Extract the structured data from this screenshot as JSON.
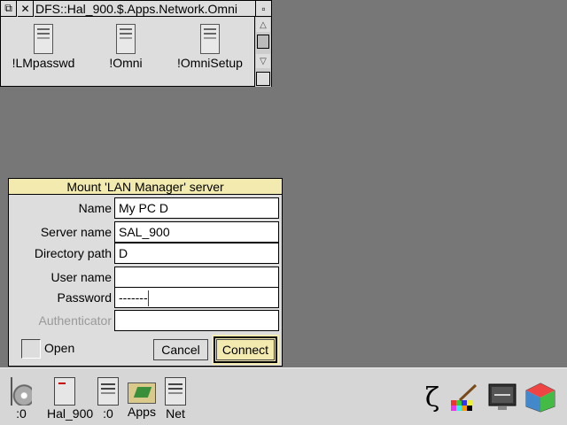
{
  "filer": {
    "title": "DFS::Hal_900.$.Apps.Network.Omni",
    "files": [
      "!LMpasswd",
      "!Omni",
      "!OmniSetup"
    ]
  },
  "dialog": {
    "title": "Mount 'LAN Manager' server",
    "fields": [
      {
        "label": "Name",
        "value": "My PC D"
      },
      {
        "label": "Server name",
        "value": "SAL_900"
      },
      {
        "label": "Directory path",
        "value": "D"
      },
      {
        "label": "User name",
        "value": ""
      },
      {
        "label": "Password",
        "value": "-------"
      },
      {
        "label": "Authenticator",
        "value": ""
      }
    ],
    "option_label": "Open",
    "cancel_label": "Cancel",
    "connect_label": "Connect"
  },
  "iconbar": {
    "left": [
      {
        "label": ":0",
        "icon": "floppy-disc-icon"
      },
      {
        "label": "Hal_900",
        "icon": "hard-drive-icon"
      },
      {
        "label": ":0",
        "icon": "network-drive-icon"
      },
      {
        "label": "Apps",
        "icon": "apps-folder-icon"
      },
      {
        "label": "Net",
        "icon": "network-icon"
      }
    ],
    "right": [
      "zeta-icon",
      "paint-icon",
      "display-mode-icon",
      "task-manager-icon"
    ]
  },
  "colors": {
    "desktop": "#777777",
    "window": "#dddddd",
    "title_highlight": "#f2eaae",
    "caret": "#dd0000"
  }
}
